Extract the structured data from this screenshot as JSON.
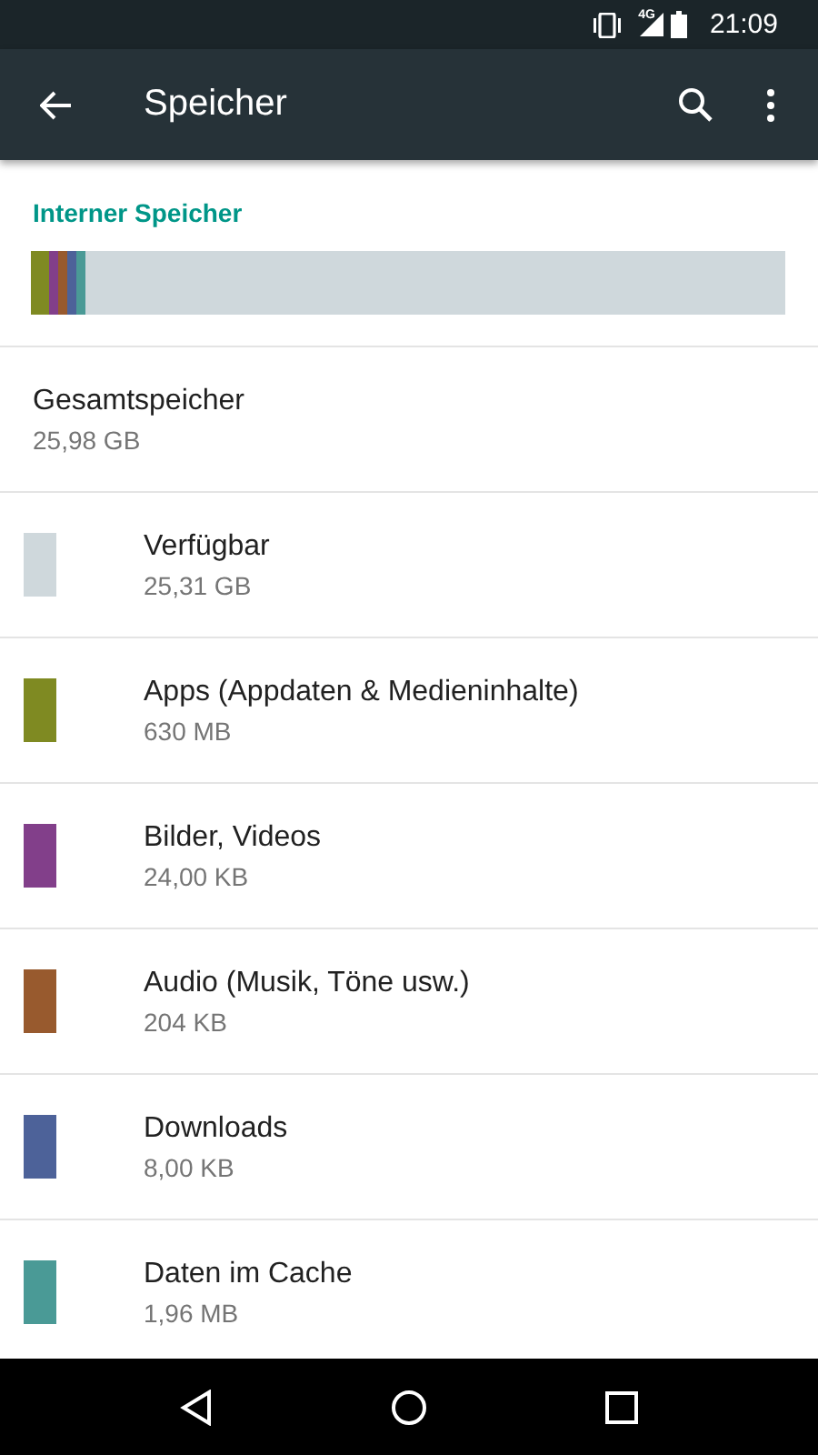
{
  "status_bar": {
    "network": "4G",
    "time": "21:09"
  },
  "toolbar": {
    "title": "Speicher"
  },
  "section": {
    "title": "Interner Speicher"
  },
  "storage_bar": {
    "segments": [
      {
        "color": "#7f8a22",
        "level": 0.024
      },
      {
        "color": "#823f8a",
        "level": 0.012
      },
      {
        "color": "#985a2e",
        "level": 0.012
      },
      {
        "color": "#4d6299",
        "level": 0.012
      },
      {
        "color": "#4a9a96",
        "level": 0.012
      }
    ]
  },
  "total": {
    "label": "Gesamtspeicher",
    "value": "25,98 GB"
  },
  "categories": [
    {
      "label": "Verfügbar",
      "value": "25,31 GB",
      "color": "#cfd8dc"
    },
    {
      "label": "Apps (Appdaten & Medieninhalte)",
      "value": "630 MB",
      "color": "#7f8a22"
    },
    {
      "label": "Bilder, Videos",
      "value": "24,00 KB",
      "color": "#823f8a"
    },
    {
      "label": "Audio (Musik, Töne usw.)",
      "value": "204 KB",
      "color": "#985a2e"
    },
    {
      "label": "Downloads",
      "value": "8,00 KB",
      "color": "#4d6299"
    },
    {
      "label": "Daten im Cache",
      "value": "1,96 MB",
      "color": "#4a9a96"
    }
  ]
}
